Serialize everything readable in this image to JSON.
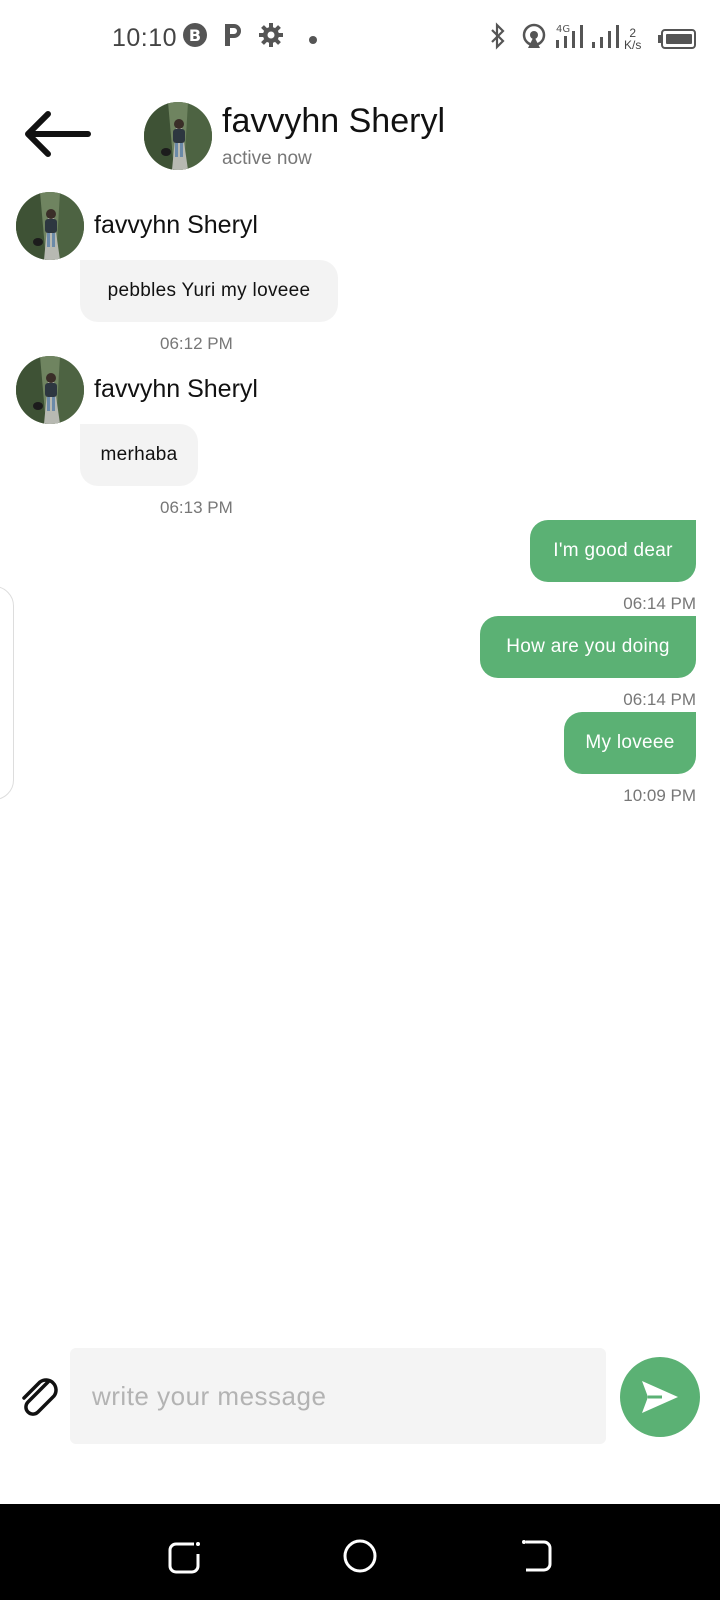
{
  "status_bar": {
    "time": "10:10",
    "icons": [
      "b-badge-icon",
      "parking-icon",
      "gear-icon",
      "notification-dot-icon",
      "bluetooth-icon",
      "hotspot-icon",
      "signal-4g-icon",
      "signal-icon",
      "battery-icon"
    ],
    "network_label": "4G",
    "speed_value": "2",
    "speed_unit": "K/s"
  },
  "header": {
    "contact_name": "favvyhn Sheryl",
    "status": "active now"
  },
  "messages": [
    {
      "direction": "incoming",
      "sender": "favvyhn Sheryl",
      "text": "pebbles Yuri my loveee",
      "time": "06:12 PM"
    },
    {
      "direction": "incoming",
      "sender": "favvyhn Sheryl",
      "text": "merhaba",
      "time": "06:13 PM"
    },
    {
      "direction": "outgoing",
      "text": "I'm good dear",
      "time": "06:14 PM"
    },
    {
      "direction": "outgoing",
      "text": "How are you doing",
      "time": "06:14 PM"
    },
    {
      "direction": "outgoing",
      "text": "My loveee",
      "time": "10:09 PM"
    }
  ],
  "composer": {
    "placeholder": "write your message"
  },
  "colors": {
    "accent": "#5bb174",
    "incoming_bubble": "#f3f3f3",
    "input_bg": "#f4f4f4"
  }
}
